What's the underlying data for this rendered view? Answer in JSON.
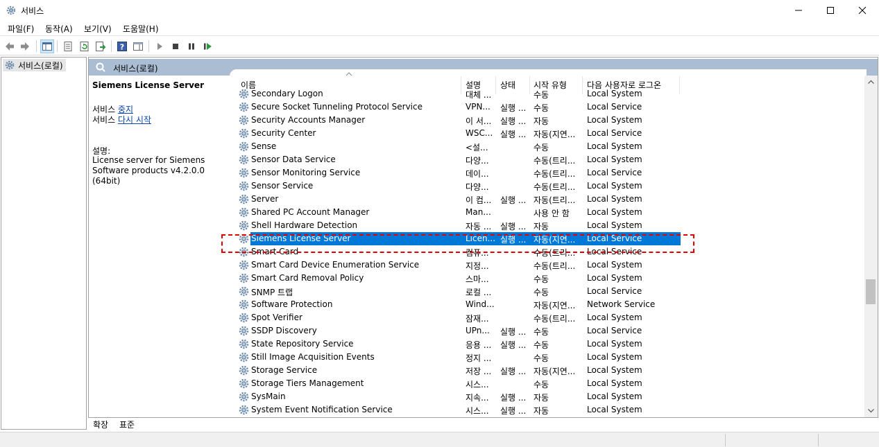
{
  "window": {
    "title": "서비스",
    "icon": "gear-icon",
    "controls": [
      "minimize-icon",
      "maximize-icon",
      "close-icon"
    ]
  },
  "menu": [
    {
      "label": "파일(F)"
    },
    {
      "label": "동작(A)"
    },
    {
      "label": "보기(V)"
    },
    {
      "label": "도움말(H)"
    }
  ],
  "toolbar": {
    "icons": [
      "back-arrow-icon",
      "forward-arrow-icon",
      "show-hide-tree-icon",
      "properties-icon",
      "refresh-icon",
      "export-list-icon",
      "help-icon",
      "show-hide-action-pane-icon",
      "start-service-icon",
      "stop-service-icon",
      "pause-service-icon",
      "restart-service-icon"
    ]
  },
  "tree": {
    "root_label": "서비스(로컬)"
  },
  "pane_header": {
    "label": "서비스(로컬)"
  },
  "details": {
    "service_name": "Siemens License Server",
    "action1_prefix": "서비스",
    "action1_link": "중지",
    "action2_prefix": "서비스",
    "action2_link": "다시 시작",
    "desc_label": "설명:",
    "desc_text": "License server for Siemens Software products v4.2.0.0 (64bit)"
  },
  "columns": {
    "name": "이름",
    "description": "설명",
    "status": "상태",
    "startup_type": "시작 유형",
    "logon_as": "다음 사용자로 로그온"
  },
  "rows": [
    {
      "name": "Secondary Logon",
      "desc": "대체 ...",
      "status": "",
      "start": "수동",
      "logon": "Local System"
    },
    {
      "name": "Secure Socket Tunneling Protocol Service",
      "desc": "VPN...",
      "status": "실행 ...",
      "start": "수동",
      "logon": "Local Service"
    },
    {
      "name": "Security Accounts Manager",
      "desc": "이 서...",
      "status": "실행 ...",
      "start": "자동",
      "logon": "Local System"
    },
    {
      "name": "Security Center",
      "desc": "WSC...",
      "status": "실행 ...",
      "start": "자동(지연...",
      "logon": "Local Service"
    },
    {
      "name": "Sense",
      "desc": "<설...",
      "status": "",
      "start": "수동",
      "logon": "Local System"
    },
    {
      "name": "Sensor Data Service",
      "desc": "다양...",
      "status": "",
      "start": "수동(트리...",
      "logon": "Local System"
    },
    {
      "name": "Sensor Monitoring Service",
      "desc": "데이...",
      "status": "",
      "start": "수동(트리...",
      "logon": "Local Service"
    },
    {
      "name": "Sensor Service",
      "desc": "다양...",
      "status": "",
      "start": "수동(트리...",
      "logon": "Local System"
    },
    {
      "name": "Server",
      "desc": "이 컴...",
      "status": "실행 ...",
      "start": "자동(트리...",
      "logon": "Local System"
    },
    {
      "name": "Shared PC Account Manager",
      "desc": "Man...",
      "status": "",
      "start": "사용 안 함",
      "logon": "Local System"
    },
    {
      "name": "Shell Hardware Detection",
      "desc": "자동 ...",
      "status": "실행 ...",
      "start": "자동",
      "logon": "Local System"
    },
    {
      "name": "Siemens License Server",
      "desc": "Licen...",
      "status": "실행 ...",
      "start": "자동(지연...",
      "logon": "Local Service",
      "selected": true
    },
    {
      "name": "Smart Card",
      "desc": "컴퓨...",
      "status": "",
      "start": "수동(트리...",
      "logon": "Local Service"
    },
    {
      "name": "Smart Card Device Enumeration Service",
      "desc": "지정...",
      "status": "",
      "start": "수동(트리...",
      "logon": "Local System"
    },
    {
      "name": "Smart Card Removal Policy",
      "desc": "스마...",
      "status": "",
      "start": "수동",
      "logon": "Local System"
    },
    {
      "name": "SNMP 트랩",
      "desc": "로컬 ...",
      "status": "",
      "start": "수동",
      "logon": "Local Service"
    },
    {
      "name": "Software Protection",
      "desc": "Wind...",
      "status": "",
      "start": "자동(지연...",
      "logon": "Network Service"
    },
    {
      "name": "Spot Verifier",
      "desc": "잠재...",
      "status": "",
      "start": "수동(트리...",
      "logon": "Local System"
    },
    {
      "name": "SSDP Discovery",
      "desc": "UPn...",
      "status": "실행 ...",
      "start": "수동",
      "logon": "Local Service"
    },
    {
      "name": "State Repository Service",
      "desc": "응용 ...",
      "status": "실행 ...",
      "start": "수동",
      "logon": "Local System"
    },
    {
      "name": "Still Image Acquisition Events",
      "desc": "정지 ...",
      "status": "",
      "start": "수동",
      "logon": "Local System"
    },
    {
      "name": "Storage Service",
      "desc": "저장 ...",
      "status": "실행 ...",
      "start": "자동(지연...",
      "logon": "Local System"
    },
    {
      "name": "Storage Tiers Management",
      "desc": "시스...",
      "status": "",
      "start": "수동",
      "logon": "Local System"
    },
    {
      "name": "SysMain",
      "desc": "지속...",
      "status": "실행 ...",
      "start": "자동",
      "logon": "Local System"
    },
    {
      "name": "System Event Notification Service",
      "desc": "시스...",
      "status": "실행 ...",
      "start": "자동",
      "logon": "Local System"
    }
  ],
  "tabs": [
    {
      "label": "확장"
    },
    {
      "label": "표준"
    }
  ],
  "colors": {
    "selection": "#0078d7",
    "pane_header": "#aabdd2",
    "highlight_outline": "#e00000",
    "link": "#0645ad"
  }
}
